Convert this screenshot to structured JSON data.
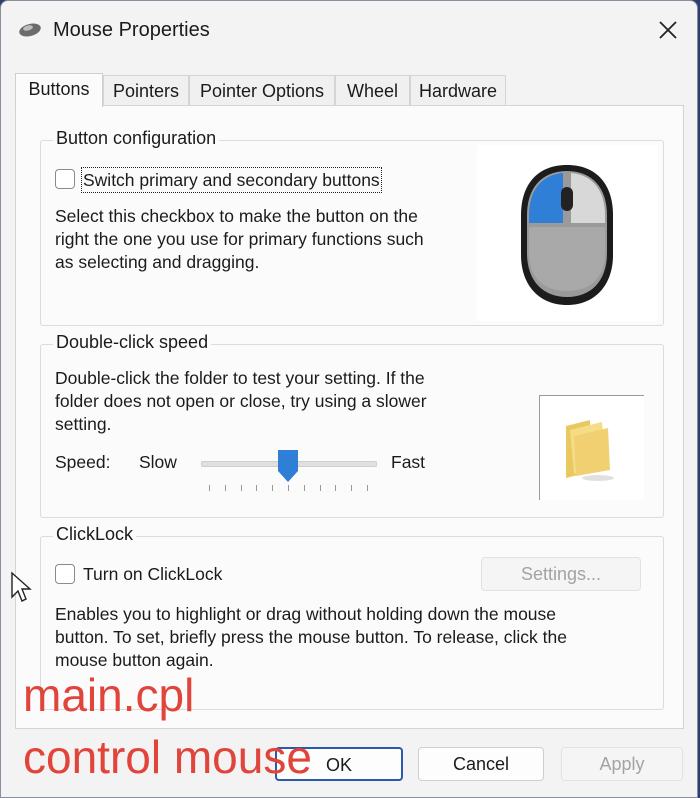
{
  "window": {
    "title": "Mouse Properties"
  },
  "tabs": [
    {
      "label": "Buttons",
      "active": true
    },
    {
      "label": "Pointers",
      "active": false
    },
    {
      "label": "Pointer Options",
      "active": false
    },
    {
      "label": "Wheel",
      "active": false
    },
    {
      "label": "Hardware",
      "active": false
    }
  ],
  "button_config": {
    "title": "Button configuration",
    "checkbox_label": "Switch primary and secondary buttons",
    "checked": false,
    "description": [
      "Select this checkbox to make the button on the",
      "right the one you use for primary functions such",
      "as selecting and dragging."
    ]
  },
  "double_click": {
    "title": "Double-click speed",
    "description": [
      "Double-click the folder to test your setting. If the",
      "folder does not open or close, try using a slower",
      "setting."
    ],
    "speed_label": "Speed:",
    "slow_label": "Slow",
    "fast_label": "Fast",
    "speed_value": 0.5
  },
  "clicklock": {
    "title": "ClickLock",
    "checkbox_label": "Turn on ClickLock",
    "checked": false,
    "settings_button": "Settings...",
    "description": [
      "Enables you to highlight or drag without holding down the mouse",
      "button. To set, briefly press the mouse button. To release, click the",
      "mouse button again."
    ]
  },
  "footer": {
    "ok": "OK",
    "cancel": "Cancel",
    "apply": "Apply"
  },
  "overlay": {
    "line1": "main.cpl",
    "line2": "control mouse"
  },
  "colors": {
    "accent": "#2f7fd6",
    "overlay_text": "#e0443a"
  }
}
